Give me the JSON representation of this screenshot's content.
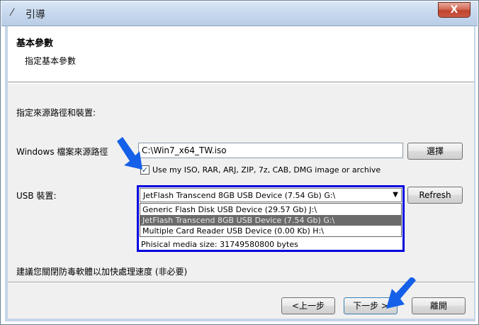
{
  "window": {
    "title": "引導",
    "title_icon": "wand-icon",
    "close_label": "X"
  },
  "header": {
    "title": "基本參數",
    "subtitle": "指定基本參數"
  },
  "main": {
    "section_label": "指定來源路徑和裝置:",
    "source_label": "Windows 檔案來源路徑",
    "source_path": "C:\\Win7_x64_TW.iso",
    "browse_label": "選擇",
    "checkbox_checked": true,
    "checkbox_label": "Use my ISO, RAR, ARJ, ZIP, 7z, CAB, DMG image or archive",
    "usb_label": "USB 裝置:",
    "usb_selected": "JetFlash Transcend 8GB USB Device (7.54 Gb) G:\\",
    "refresh_label": "Refresh",
    "usb_options": [
      "Generic Flash Disk USB Device (29.57 Gb) J:\\",
      "JetFlash Transcend 8GB USB Device (7.54 Gb) G:\\",
      "Multiple Card  Reader USB Device (0.00 Kb) H:\\"
    ],
    "media_size": "Phisical media size: 31749580800 bytes",
    "note": "建議您關閉防毒軟體以加快處理速度 (非必要)"
  },
  "footer": {
    "back_label": "<上一步",
    "next_label": "下一步 >",
    "exit_label": "離開"
  },
  "colors": {
    "highlight": "#0000dd",
    "annotation_arrow": "#1560e8",
    "selected_row": "#6b6b6b"
  }
}
